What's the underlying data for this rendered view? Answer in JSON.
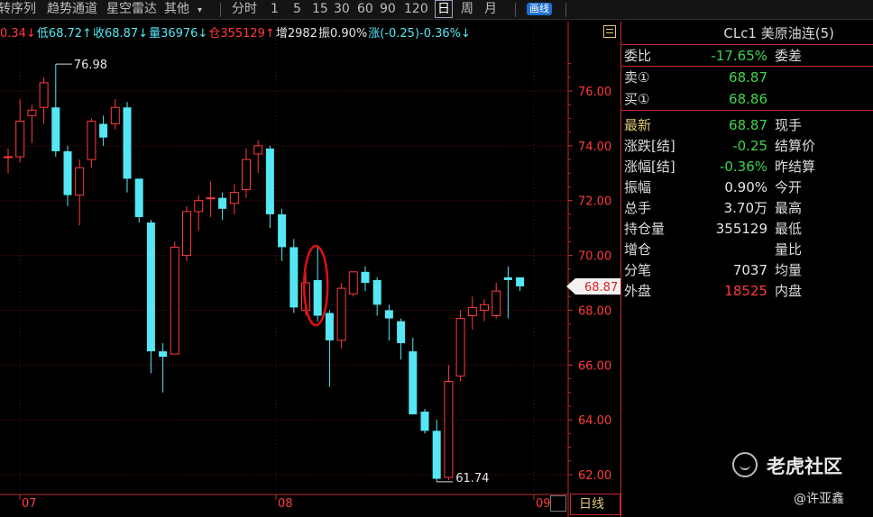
{
  "toolbar": {
    "items": [
      "转序列",
      "趋势通道",
      "星空雷达",
      "其他"
    ],
    "periods": [
      "分时",
      "1",
      "5",
      "15",
      "30",
      "60",
      "90",
      "120",
      "日",
      "周",
      "月"
    ],
    "active_period": "日",
    "draw_button": "画线",
    "dropdown_icon": "caret-down-icon"
  },
  "info": {
    "high": "0.34↓",
    "low": "低68.72↑",
    "close": "收68.87↓",
    "volume": "量36976↓",
    "open_interest": "仓355129↑",
    "oi_change": "增2982",
    "amplitude": "振0.90%",
    "change": "涨(-0.25)-0.36%↓"
  },
  "panel": {
    "title": "CLc1 美原油连(5)",
    "menu_icon": "grid-icon",
    "rows": [
      {
        "label": "委比",
        "value": "-17.65%",
        "label2": "委差",
        "color": "#3fd54f"
      },
      {
        "label": "卖①",
        "value": "68.87",
        "label2": "",
        "color": "#3fd54f"
      },
      {
        "label": "买①",
        "value": "68.86",
        "label2": "",
        "color": "#3fd54f"
      },
      {
        "label": "最新",
        "value": "68.87",
        "label2": "现手",
        "color": "#3fd54f",
        "label_color": "#e0c870"
      },
      {
        "label": "涨跌[结]",
        "value": "-0.25",
        "label2": "结算价",
        "color": "#3fd54f"
      },
      {
        "label": "涨幅[结]",
        "value": "-0.36%",
        "label2": "昨结算",
        "color": "#3fd54f"
      },
      {
        "label": "振幅",
        "value": "0.90%",
        "label2": "今开",
        "color": "#e6e6e6"
      },
      {
        "label": "总手",
        "value": "3.70万",
        "label2": "最高",
        "color": "#e6e6e6"
      },
      {
        "label": "持仓量",
        "value": "355129",
        "label2": "最低",
        "color": "#e6e6e6"
      },
      {
        "label": "增仓",
        "value": "",
        "label2": "量比",
        "color": "#e6e6e6"
      },
      {
        "label": "分笔",
        "value": "7037",
        "label2": "均量",
        "color": "#e6e6e6"
      },
      {
        "label": "外盘",
        "value": "18525",
        "label2": "内盘",
        "color": "#ff3b3b"
      }
    ]
  },
  "chart_data": {
    "type": "candlestick",
    "ylim": [
      61.5,
      78.3
    ],
    "y_ticks": [
      "76.00",
      "74.00",
      "72.00",
      "70.00",
      "68.00",
      "66.00",
      "64.00",
      "62.00"
    ],
    "x_labels": [
      "07",
      "08",
      "09"
    ],
    "annotations": {
      "max_label": "76.98",
      "min_label": "61.74",
      "last_price": "68.87"
    },
    "colors": {
      "up": "#ff3b3b",
      "down": "#55e7f4",
      "grid": "#5a1010",
      "axis": "#c42a2a",
      "text": "#ff3b3b",
      "circle": "#e01010"
    },
    "candles": [
      {
        "o": 73.6,
        "h": 73.9,
        "l": 73.0,
        "c": 73.6
      },
      {
        "o": 73.6,
        "h": 75.7,
        "l": 73.4,
        "c": 74.9
      },
      {
        "o": 75.1,
        "h": 75.5,
        "l": 74.1,
        "c": 75.3
      },
      {
        "o": 75.4,
        "h": 76.5,
        "l": 74.8,
        "c": 76.3
      },
      {
        "o": 75.4,
        "h": 76.98,
        "l": 73.6,
        "c": 73.8
      },
      {
        "o": 73.8,
        "h": 74.0,
        "l": 71.8,
        "c": 72.2
      },
      {
        "o": 72.2,
        "h": 73.5,
        "l": 71.1,
        "c": 73.2
      },
      {
        "o": 73.5,
        "h": 75.0,
        "l": 73.2,
        "c": 74.9
      },
      {
        "o": 74.8,
        "h": 75.1,
        "l": 74.0,
        "c": 74.3
      },
      {
        "o": 74.8,
        "h": 75.7,
        "l": 74.6,
        "c": 75.4
      },
      {
        "o": 75.4,
        "h": 75.6,
        "l": 72.3,
        "c": 72.8
      },
      {
        "o": 72.8,
        "h": 72.8,
        "l": 71.2,
        "c": 71.4
      },
      {
        "o": 71.2,
        "h": 71.3,
        "l": 65.7,
        "c": 66.5
      },
      {
        "o": 66.5,
        "h": 66.8,
        "l": 65.0,
        "c": 66.3
      },
      {
        "o": 66.4,
        "h": 70.5,
        "l": 66.4,
        "c": 70.3
      },
      {
        "o": 70.0,
        "h": 71.8,
        "l": 69.8,
        "c": 71.6
      },
      {
        "o": 71.6,
        "h": 72.2,
        "l": 70.9,
        "c": 72.0
      },
      {
        "o": 72.1,
        "h": 72.7,
        "l": 71.4,
        "c": 72.1
      },
      {
        "o": 72.1,
        "h": 72.3,
        "l": 71.3,
        "c": 71.7
      },
      {
        "o": 71.9,
        "h": 72.6,
        "l": 71.5,
        "c": 72.3
      },
      {
        "o": 72.4,
        "h": 73.9,
        "l": 72.1,
        "c": 73.5
      },
      {
        "o": 73.7,
        "h": 74.2,
        "l": 73.0,
        "c": 74.0
      },
      {
        "o": 73.9,
        "h": 74.0,
        "l": 71.0,
        "c": 71.5
      },
      {
        "o": 71.5,
        "h": 71.7,
        "l": 69.8,
        "c": 70.3
      },
      {
        "o": 70.3,
        "h": 70.6,
        "l": 67.9,
        "c": 68.1
      },
      {
        "o": 68.0,
        "h": 69.4,
        "l": 67.8,
        "c": 69.0
      },
      {
        "o": 69.1,
        "h": 70.3,
        "l": 67.6,
        "c": 67.8
      },
      {
        "o": 67.9,
        "h": 68.0,
        "l": 65.2,
        "c": 66.9
      },
      {
        "o": 66.9,
        "h": 69.0,
        "l": 66.6,
        "c": 68.8
      },
      {
        "o": 68.6,
        "h": 69.4,
        "l": 68.5,
        "c": 69.4
      },
      {
        "o": 69.4,
        "h": 69.6,
        "l": 68.7,
        "c": 69.0
      },
      {
        "o": 69.1,
        "h": 69.2,
        "l": 67.8,
        "c": 68.2
      },
      {
        "o": 68.0,
        "h": 68.2,
        "l": 66.9,
        "c": 67.7
      },
      {
        "o": 67.6,
        "h": 67.7,
        "l": 66.2,
        "c": 66.8
      },
      {
        "o": 66.5,
        "h": 67.0,
        "l": 64.2,
        "c": 64.2
      },
      {
        "o": 64.3,
        "h": 64.4,
        "l": 63.5,
        "c": 63.6
      },
      {
        "o": 63.6,
        "h": 64.0,
        "l": 61.74,
        "c": 61.85
      },
      {
        "o": 61.9,
        "h": 66.0,
        "l": 61.8,
        "c": 65.4
      },
      {
        "o": 65.6,
        "h": 68.0,
        "l": 65.4,
        "c": 67.7
      },
      {
        "o": 67.8,
        "h": 68.5,
        "l": 67.3,
        "c": 68.1
      },
      {
        "o": 68.0,
        "h": 68.4,
        "l": 67.6,
        "c": 68.2
      },
      {
        "o": 67.8,
        "h": 69.0,
        "l": 67.7,
        "c": 68.7
      },
      {
        "o": 69.2,
        "h": 69.6,
        "l": 67.7,
        "c": 69.1
      },
      {
        "o": 69.2,
        "h": 69.2,
        "l": 68.7,
        "c": 68.87
      }
    ]
  },
  "bottom": {
    "tab_label": "日线"
  },
  "watermark": {
    "brand": "老虎社区",
    "author": "@许亚鑫"
  }
}
